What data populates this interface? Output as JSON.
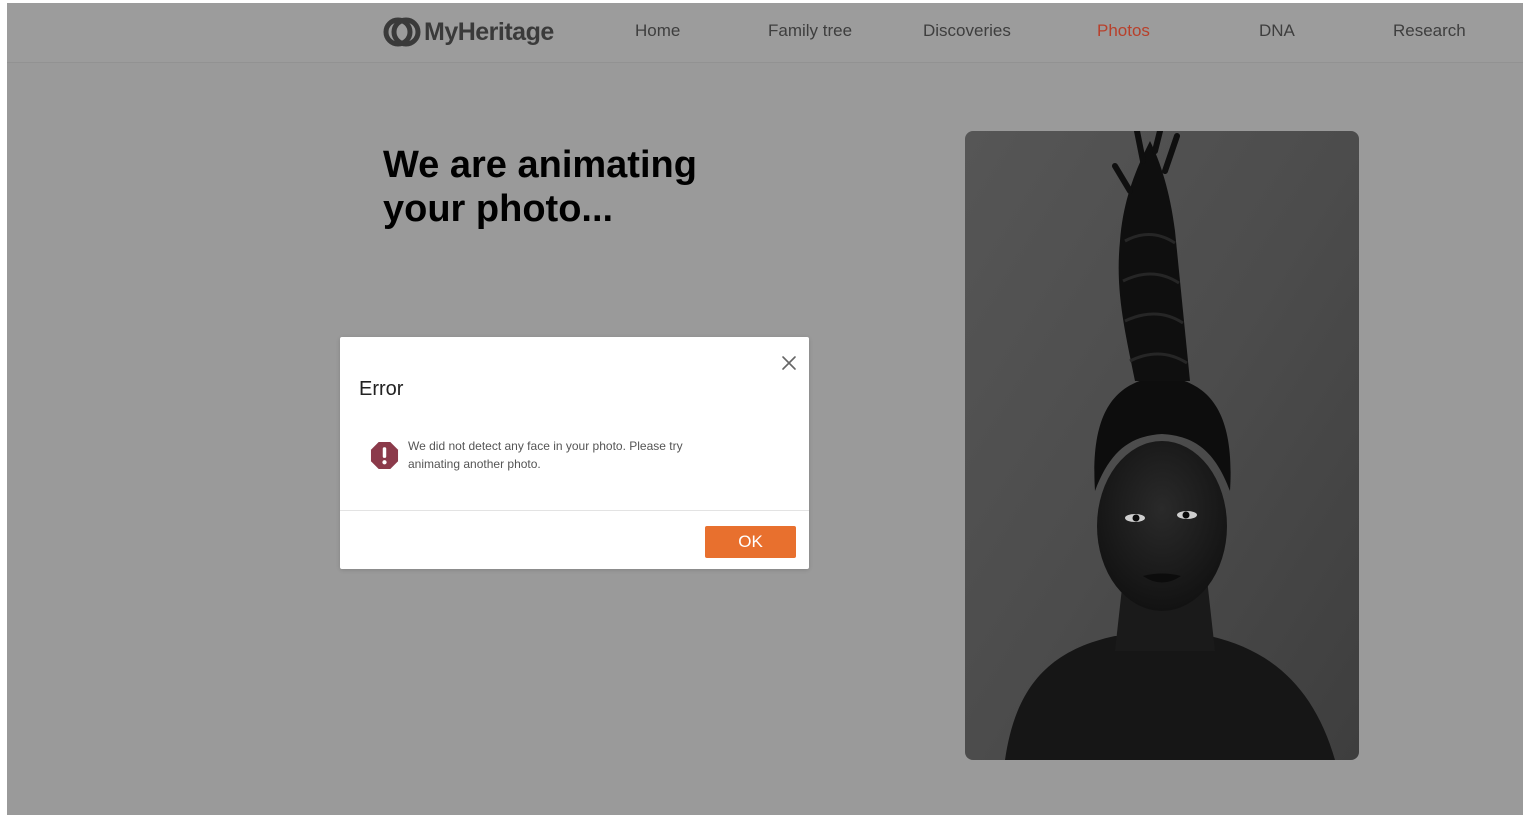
{
  "brand": {
    "logo_text": "MyHeritage",
    "logo_icon": "myheritage-logo-icon"
  },
  "nav": {
    "items": [
      {
        "label": "Home",
        "active": false
      },
      {
        "label": "Family tree",
        "active": false
      },
      {
        "label": "Discoveries",
        "active": false
      },
      {
        "label": "Photos",
        "active": true
      },
      {
        "label": "DNA",
        "active": false
      },
      {
        "label": "Research",
        "active": false
      }
    ]
  },
  "main": {
    "headline": "We are animating your photo..."
  },
  "modal": {
    "title": "Error",
    "message": "We did not detect any face in your photo. Please try animating another photo.",
    "ok_label": "OK",
    "close_icon": "close-icon",
    "alert_icon": "exclamation-octagon-icon"
  },
  "colors": {
    "overlay_background": "#9a9a9a",
    "active_nav": "#b8402b",
    "ok_button": "#e8702e",
    "alert_icon": "#8b3a4a"
  }
}
